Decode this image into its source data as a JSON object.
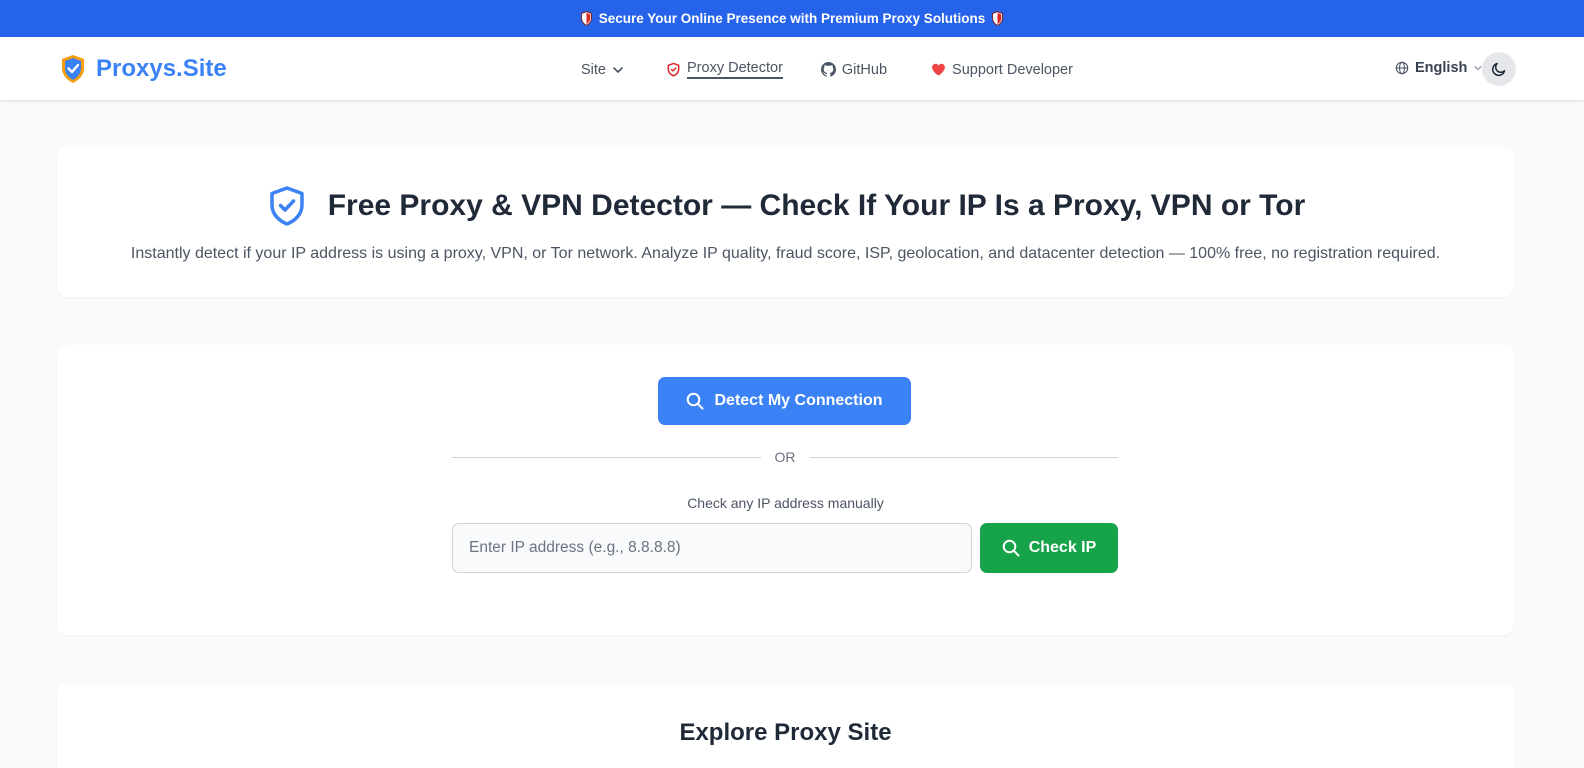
{
  "promo": {
    "text": "Secure Your Online Presence with Premium Proxy Solutions",
    "icon": "shield-icon"
  },
  "nav": {
    "brand": "Proxys.Site",
    "links": [
      {
        "label": "Site",
        "icon": "chevron-down-icon"
      },
      {
        "label": "Proxy Detector",
        "icon": "shield-icon"
      },
      {
        "label": "GitHub",
        "icon": "github-icon"
      },
      {
        "label": "Support Developer",
        "icon": "heart-icon"
      }
    ],
    "language": "English"
  },
  "hero": {
    "title": "Free Proxy & VPN Detector — Check If Your IP Is a Proxy, VPN or Tor",
    "subtitle": "Instantly detect if your IP address is using a proxy, VPN, or Tor network. Analyze IP quality, fraud score, ISP, geolocation, and datacenter detection — 100% free, no registration required."
  },
  "tool": {
    "detect_label": "Detect My Connection",
    "or_label": "OR",
    "manual_label": "Check any IP address manually",
    "ip_placeholder": "Enter IP address (e.g., 8.8.8.8)",
    "ip_value": "",
    "check_label": "Check IP"
  },
  "explore": {
    "title": "Explore Proxy Site"
  },
  "colors": {
    "promo_bg": "#2563eb",
    "brand": "#3b82f6",
    "detect_button": "#3b82f6",
    "check_button": "#16a34a",
    "heart": "#ef4444",
    "shield_red": "#dc2626"
  }
}
